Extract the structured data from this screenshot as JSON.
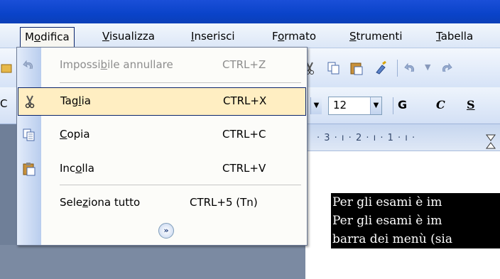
{
  "menubar": {
    "items": [
      {
        "pre": "M",
        "ul": "o",
        "post": "difica"
      },
      {
        "pre": "",
        "ul": "V",
        "post": "isualizza"
      },
      {
        "pre": "",
        "ul": "I",
        "post": "nserisci"
      },
      {
        "pre": "F",
        "ul": "o",
        "post": "rmato"
      },
      {
        "pre": "",
        "ul": "S",
        "post": "trumenti"
      },
      {
        "pre": "",
        "ul": "T",
        "post": "abella"
      }
    ]
  },
  "toolbar": {
    "font_size": "12",
    "bold": "G",
    "italic": "C",
    "underline": "S",
    "font_prefix": "C"
  },
  "ruler": {
    "text": "· 3 · ı · 2 · ı · 1 · ı ·"
  },
  "dropdown": {
    "undo": {
      "pre": "Impossi",
      "ul": "b",
      "post": "ile annullare",
      "shortcut": "CTRL+Z"
    },
    "cut": {
      "pre": "Tag",
      "ul": "l",
      "post": "ia",
      "shortcut": "CTRL+X"
    },
    "copy": {
      "pre": "",
      "ul": "C",
      "post": "opia",
      "shortcut": "CTRL+C"
    },
    "paste": {
      "pre": "Inc",
      "ul": "o",
      "post": "lla",
      "shortcut": "CTRL+V"
    },
    "select_all": {
      "pre": "Sele",
      "ul": "z",
      "post": "iona tutto",
      "shortcut": "CTRL+5 (Tn)"
    },
    "expand_glyph": "»"
  },
  "document": {
    "lines": [
      "Per gli esami è im",
      "Per gli esami è im",
      "barra dei menù (sia"
    ]
  }
}
